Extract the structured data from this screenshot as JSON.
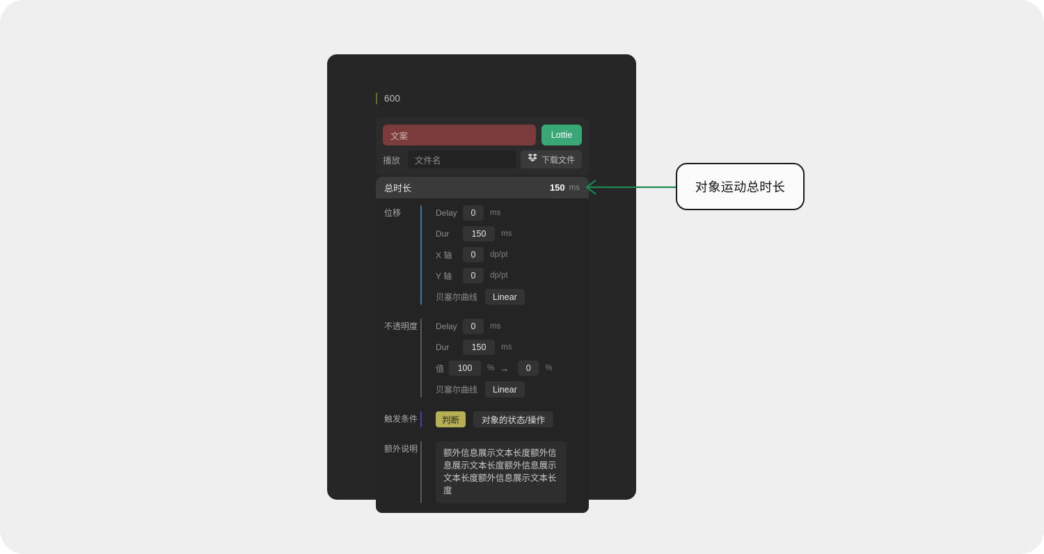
{
  "frame": {
    "accent_color": "#6b6b2e",
    "label": "600"
  },
  "file_panel": {
    "text_input_placeholder": "文案",
    "text_input_color": "#7b3b3b",
    "lottie_button": "Lottie",
    "lottie_color": "#3aa777",
    "play_label": "播放",
    "filename_placeholder": "文件名",
    "download_button": "下载文件",
    "download_icon": "dropbox-icon"
  },
  "timing_panel": {
    "total": {
      "label": "总时长",
      "value": "150",
      "unit": "ms"
    },
    "groups": [
      {
        "label": "位移",
        "bar_color": "#3b7aa8",
        "fields": [
          {
            "label": "Delay",
            "value": "0",
            "unit": "ms",
            "wide": false
          },
          {
            "label": "Dur",
            "value": "150",
            "unit": "ms",
            "wide": true
          },
          {
            "label": "X 轴",
            "value": "0",
            "unit": "dp/pt",
            "wide": false
          },
          {
            "label": "Y 轴",
            "value": "0",
            "unit": "dp/pt",
            "wide": false
          }
        ],
        "curve": {
          "label": "贝塞尔曲线",
          "value": "Linear"
        }
      },
      {
        "label": "不透明度",
        "bar_color": "#5a5a5a",
        "fields": [
          {
            "label": "Delay",
            "value": "0",
            "unit": "ms",
            "wide": false
          },
          {
            "label": "Dur",
            "value": "150",
            "unit": "ms",
            "wide": true
          }
        ],
        "value_range": {
          "label": "值",
          "from": "100",
          "from_unit": "%",
          "arrow": "→",
          "to": "0",
          "to_unit": "%"
        },
        "curve": {
          "label": "贝塞尔曲线",
          "value": "Linear"
        }
      }
    ],
    "trigger": {
      "label": "触发条件",
      "bar_color": "#4b44a8",
      "badge": "判断",
      "badge_color": "#b5b055",
      "chip": "对象的状态/操作"
    },
    "note": {
      "label": "额外说明",
      "bar_color": "#5a5a5a",
      "text": "额外信息展示文本长度额外信息展示文本长度额外信息展示文本长度额外信息展示文本长度"
    }
  },
  "callout": {
    "text": "对象运动总时长",
    "arrow_color": "#1a8a4f"
  }
}
